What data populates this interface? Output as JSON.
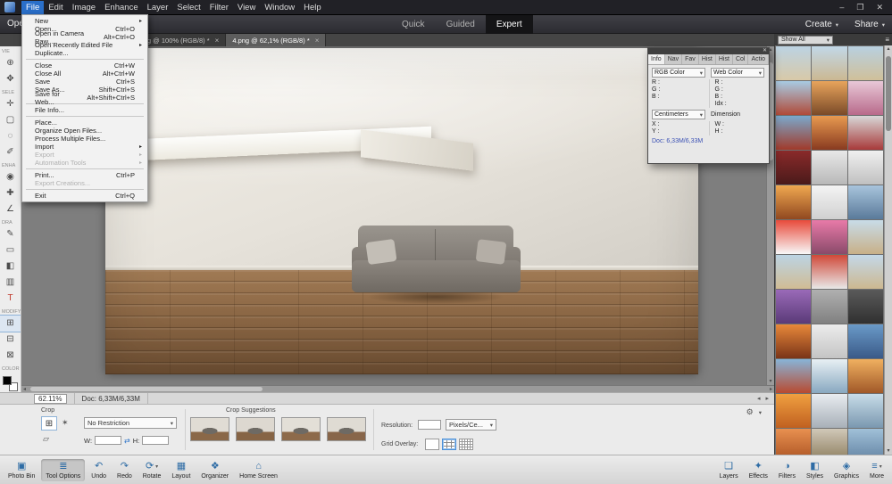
{
  "window": {
    "controls": {
      "minimize": "–",
      "maximize": "❐",
      "close": "✕"
    }
  },
  "icons": {
    "caret_down": "▾",
    "submenu_arrow": "▸",
    "close": "✕",
    "tab_close": "×",
    "swap": "⇄",
    "gear": "⚙",
    "panel_menu": "≡",
    "scroll_up": "▴",
    "scroll_down": "▾",
    "scroll_left": "◂",
    "scroll_right": "▸",
    "nav_arrows": "◂ ▸"
  },
  "menubar": {
    "items": [
      {
        "label": "File",
        "active": true
      },
      {
        "label": "Edit"
      },
      {
        "label": "Image"
      },
      {
        "label": "Enhance"
      },
      {
        "label": "Layer"
      },
      {
        "label": "Select"
      },
      {
        "label": "Filter"
      },
      {
        "label": "View"
      },
      {
        "label": "Window"
      },
      {
        "label": "Help"
      }
    ]
  },
  "file_menu": {
    "items": [
      {
        "label": "New",
        "submenu": true
      },
      {
        "label": "Open...",
        "shortcut": "Ctrl+O"
      },
      {
        "label": "Open in Camera Raw...",
        "shortcut": "Alt+Ctrl+O"
      },
      {
        "label": "Open Recently Edited File",
        "submenu": true
      },
      {
        "label": "Duplicate..."
      },
      {
        "sep": true
      },
      {
        "label": "Close",
        "shortcut": "Ctrl+W"
      },
      {
        "label": "Close All",
        "shortcut": "Alt+Ctrl+W"
      },
      {
        "label": "Save",
        "shortcut": "Ctrl+S"
      },
      {
        "label": "Save As...",
        "shortcut": "Shift+Ctrl+S"
      },
      {
        "label": "Save for Web...",
        "shortcut": "Alt+Shift+Ctrl+S"
      },
      {
        "sep": true
      },
      {
        "label": "File Info..."
      },
      {
        "sep": true
      },
      {
        "label": "Place..."
      },
      {
        "label": "Organize Open Files..."
      },
      {
        "label": "Process Multiple Files..."
      },
      {
        "label": "Import",
        "submenu": true
      },
      {
        "label": "Export",
        "submenu": true,
        "disabled": true
      },
      {
        "label": "Automation Tools",
        "submenu": true,
        "disabled": true
      },
      {
        "sep": true
      },
      {
        "label": "Print...",
        "shortcut": "Ctrl+P"
      },
      {
        "label": "Export Creations...",
        "disabled": true
      },
      {
        "sep": true
      },
      {
        "label": "Exit",
        "shortcut": "Ctrl+Q"
      }
    ]
  },
  "modebar": {
    "open_label": "Open",
    "tabs": [
      {
        "label": "Quick"
      },
      {
        "label": "Guided"
      },
      {
        "label": "Expert",
        "active": true
      }
    ],
    "create_label": "Create",
    "share_label": "Share"
  },
  "tabbar": {
    "tabs": [
      {
        "label": ".jpg @ 100% (RGB/8) *"
      },
      {
        "label": "4.png @ 62,1% (RGB/8) *",
        "active": true
      }
    ]
  },
  "toolbox": {
    "sections": [
      {
        "label": "VIE",
        "icons": [
          {
            "name": "zoom-tool-icon",
            "glyph": "⊕"
          },
          {
            "name": "hand-tool-icon",
            "glyph": "✥"
          }
        ]
      },
      {
        "label": "SELE",
        "icons": [
          {
            "name": "move-tool-icon",
            "glyph": "✛"
          },
          {
            "name": "marquee-tool-icon",
            "glyph": "▢"
          },
          {
            "name": "lasso-tool-icon",
            "glyph": "◌"
          },
          {
            "name": "quick-selection-tool-icon",
            "glyph": "✐"
          }
        ]
      },
      {
        "label": "ENHA",
        "icons": [
          {
            "name": "red-eye-tool-icon",
            "glyph": "◉"
          },
          {
            "name": "spot-healing-tool-icon",
            "glyph": "✚"
          },
          {
            "name": "straighten-tool-icon",
            "glyph": "∠"
          }
        ]
      },
      {
        "label": "DRA",
        "icons": [
          {
            "name": "brush-tool-icon",
            "glyph": "✎"
          },
          {
            "name": "eraser-tool-icon",
            "glyph": "▭"
          },
          {
            "name": "paint-bucket-tool-icon",
            "glyph": "◧"
          },
          {
            "name": "gradient-tool-icon",
            "glyph": "▥"
          },
          {
            "name": "type-tool-icon",
            "glyph": "T",
            "color": "#c0392b"
          }
        ]
      },
      {
        "label": "MODIFY",
        "icons": [
          {
            "name": "crop-tool-icon",
            "glyph": "⊞",
            "active": true
          },
          {
            "name": "recompose-tool-icon",
            "glyph": "⊟"
          },
          {
            "name": "content-aware-move-tool-icon",
            "glyph": "⊠"
          }
        ]
      },
      {
        "label": "COLOR",
        "icons": [],
        "swatches": true
      }
    ]
  },
  "info_panel": {
    "tabs": [
      {
        "label": "Info",
        "active": true
      },
      {
        "label": "Nav"
      },
      {
        "label": "Fav"
      },
      {
        "label": "Hist"
      },
      {
        "label": "Hist"
      },
      {
        "label": "Col"
      },
      {
        "label": "Actio"
      }
    ],
    "rgb_dropdown": "RGB Color",
    "web_dropdown": "Web Color",
    "left_rows": [
      "R :",
      "G :",
      "B :"
    ],
    "right_rows": [
      "R :",
      "G :",
      "B :",
      "Idx :"
    ],
    "units_dropdown": "Centimeters",
    "dimension_label": "Dimension",
    "pos_rows": [
      "X :",
      "Y :"
    ],
    "dim_rows": [
      "W :",
      "H :"
    ],
    "doc_info": "Doc: 6,33M/6,33M"
  },
  "status": {
    "zoom": "62.11%",
    "doc": "Doc: 6,33M/6,33M"
  },
  "tool_options": {
    "tool_label": "Crop",
    "restriction_value": "No Restriction",
    "w_label": "W:",
    "h_label": "H:",
    "suggestions_label": "Crop Suggestions",
    "resolution_label": "Resolution:",
    "resolution_unit": "Pixels/Ce...",
    "grid_label": "Grid Overlay:",
    "suggestions": [
      {
        "wall": "#e0dcd4",
        "floor": "#8a6848"
      },
      {
        "wall": "#ddd8d0",
        "floor": "#866445"
      },
      {
        "wall": "#e3dfd7",
        "floor": "#8d6a4a"
      },
      {
        "wall": "#dfdbd3",
        "floor": "#88664a"
      }
    ]
  },
  "photo_bin": {
    "header": {
      "filter_value": "Show All"
    },
    "thumbs": [
      {
        "c1": "#bcd3e3",
        "c2": "#d8c9a8"
      },
      {
        "c1": "#c2d8e8",
        "c2": "#cbb892"
      },
      {
        "c1": "#b8d0e0",
        "c2": "#d0c09a"
      },
      {
        "c1": "#a8cbe4",
        "c2": "#b04a38"
      },
      {
        "c1": "#e8a45c",
        "c2": "#7a4a28"
      },
      {
        "c1": "#e8c8d8",
        "c2": "#b86a8a"
      },
      {
        "c1": "#7aa8cc",
        "c2": "#a03a2a"
      },
      {
        "c1": "#e89a50",
        "c2": "#883a20"
      },
      {
        "c1": "#d8d8d8",
        "c2": "#a83a3a"
      },
      {
        "c1": "#8a2a2a",
        "c2": "#4a1a1a"
      },
      {
        "c1": "#e8e8e8",
        "c2": "#b8b8b8"
      },
      {
        "c1": "#f0f0f0",
        "c2": "#c0c0c0"
      },
      {
        "c1": "#f0a850",
        "c2": "#904820"
      },
      {
        "c1": "#f4f4f4",
        "c2": "#d0d0d0"
      },
      {
        "c1": "#a8c4dc",
        "c2": "#5a7a9a"
      },
      {
        "c1": "#e84a3a",
        "c2": "#f8f8f8"
      },
      {
        "c1": "#e87aa8",
        "c2": "#8a4a6a"
      },
      {
        "c1": "#c8dce8",
        "c2": "#c8b088"
      },
      {
        "c1": "#bcd4e4",
        "c2": "#d0bc94"
      },
      {
        "c1": "#d04838",
        "c2": "#e8e8e8"
      },
      {
        "c1": "#c4d8e8",
        "c2": "#ccb890"
      },
      {
        "c1": "#9a6ab8",
        "c2": "#5a3a78"
      },
      {
        "c1": "#b0b0b0",
        "c2": "#808080"
      },
      {
        "c1": "#5a5a5a",
        "c2": "#303030"
      },
      {
        "c1": "#e8883a",
        "c2": "#7a3418"
      },
      {
        "c1": "#ececec",
        "c2": "#c4c4c4"
      },
      {
        "c1": "#6a9ac8",
        "c2": "#3a5a88"
      },
      {
        "c1": "#88b4d8",
        "c2": "#b84a30"
      },
      {
        "c1": "#e8f0f4",
        "c2": "#88a8c0"
      },
      {
        "c1": "#f0b060",
        "c2": "#a05828"
      },
      {
        "c1": "#f0a040",
        "c2": "#c06020"
      },
      {
        "c1": "#e8ecf0",
        "c2": "#a8b0b8"
      },
      {
        "c1": "#c8dce8",
        "c2": "#7a98b0"
      },
      {
        "c1": "#e89050",
        "c2": "#a85020"
      },
      {
        "c1": "#d0c8b8",
        "c2": "#8a7a5a"
      },
      {
        "c1": "#a0c0d8",
        "c2": "#6080a0"
      }
    ]
  },
  "taskbar": {
    "left": [
      {
        "label": "Photo Bin",
        "icon": "▣"
      },
      {
        "label": "Tool Options",
        "icon": "≣",
        "active": true
      },
      {
        "label": "Undo",
        "icon": "↶"
      },
      {
        "label": "Redo",
        "icon": "↷"
      },
      {
        "label": "Rotate",
        "icon": "⟳",
        "caret": true
      },
      {
        "label": "Layout",
        "icon": "▦"
      },
      {
        "label": "Organizer",
        "icon": "❖"
      },
      {
        "label": "Home Screen",
        "icon": "⌂"
      }
    ],
    "right": [
      {
        "label": "Layers",
        "icon": "❏"
      },
      {
        "label": "Effects",
        "icon": "✦"
      },
      {
        "label": "Filters",
        "icon": "◑"
      },
      {
        "label": "Styles",
        "icon": "◧"
      },
      {
        "label": "Graphics",
        "icon": "◈"
      },
      {
        "label": "More",
        "icon": "≡",
        "caret": true
      }
    ]
  }
}
